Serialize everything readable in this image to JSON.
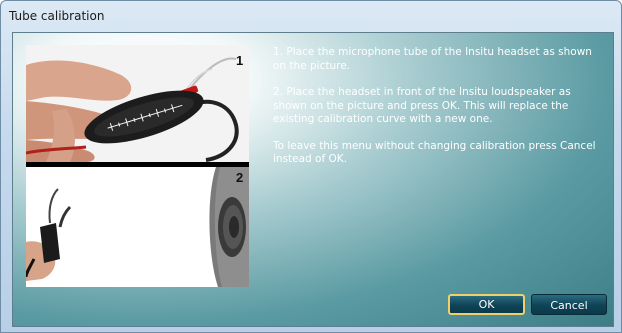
{
  "window": {
    "title": "Tube calibration"
  },
  "images": {
    "step1_number": "1",
    "step2_number": "2"
  },
  "instructions": {
    "step1": "1. Place the microphone tube of the Insitu headset as shown on the picture.",
    "step2": "2. Place the headset in front of the Insitu loudspeaker as shown on the picture and press OK. This will replace the existing calibration curve with a new one.",
    "cancel_note": "To leave this menu without changing calibration press Cancel instead of OK."
  },
  "buttons": {
    "ok_label": "OK",
    "cancel_label": "Cancel"
  },
  "colors": {
    "panel_teal": "#3d7e86",
    "button_dark": "#0f4356",
    "focus_border": "#f1cf6a"
  }
}
